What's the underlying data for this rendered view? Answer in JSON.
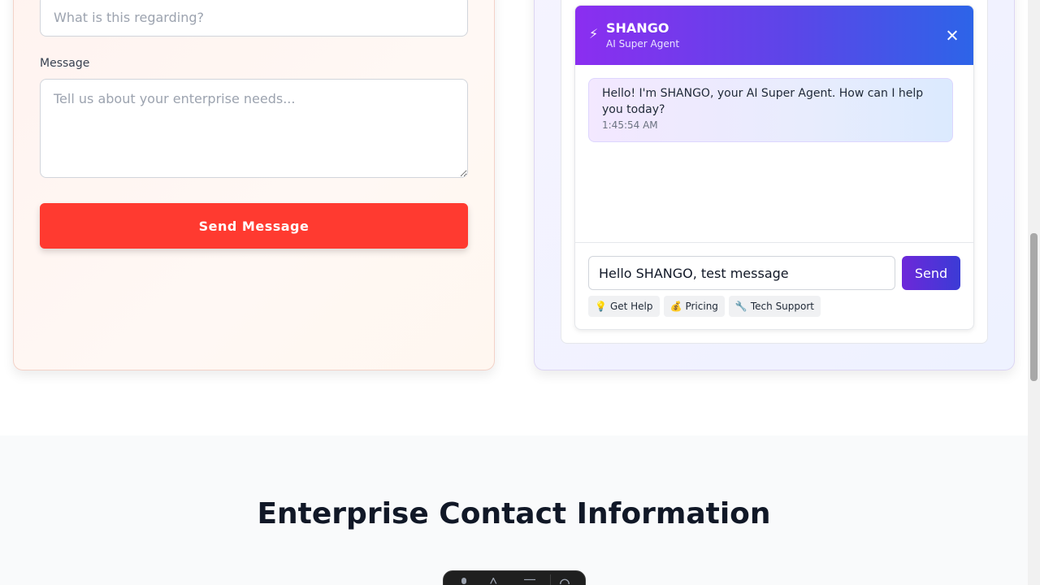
{
  "contact_form": {
    "subject_placeholder": "What is this regarding?",
    "message_label": "Message",
    "message_placeholder": "Tell us about your enterprise needs...",
    "send_button_label": "Send Message",
    "accent_color": "#ff3a30"
  },
  "chat": {
    "agent_icon": "⚡",
    "agent_name": "SHANGO",
    "agent_subtitle": "AI Super Agent",
    "close_icon": "close-icon",
    "messages": [
      {
        "sender": "bot",
        "text": "Hello! I'm SHANGO, your AI Super Agent. How can I help you today?",
        "time": "1:45:54 AM"
      }
    ],
    "input_value": "Hello SHANGO, test message",
    "send_label": "Send",
    "quick_actions": [
      {
        "icon": "💡",
        "label": "Get Help"
      },
      {
        "icon": "💰",
        "label": "Pricing"
      },
      {
        "icon": "🔧",
        "label": "Tech Support"
      }
    ],
    "header_gradient": [
      "#8b2ef0",
      "#2d64e8"
    ]
  },
  "contact_info": {
    "title": "Enterprise Contact Information"
  }
}
